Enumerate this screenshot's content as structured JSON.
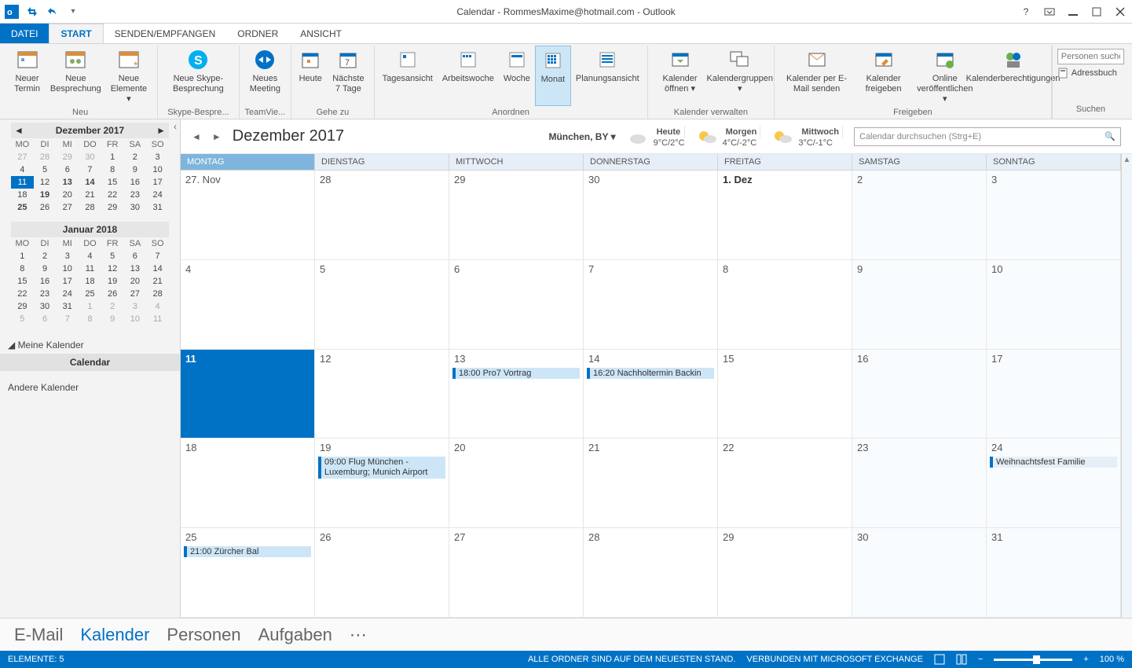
{
  "title": "Calendar - RommesMaxime@hotmail.com - Outlook",
  "tabs": {
    "file": "DATEI",
    "start": "START",
    "sendrecv": "SENDEN/EMPFANGEN",
    "folder": "ORDNER",
    "view": "ANSICHT"
  },
  "ribbon": {
    "new": {
      "termin": "Neuer Termin",
      "meeting": "Neue Besprechung",
      "elements": "Neue Elemente",
      "label": "Neu"
    },
    "skype": {
      "btn": "Neue Skype-Besprechung",
      "label": "Skype-Bespre..."
    },
    "team": {
      "btn": "Neues Meeting",
      "label": "TeamVie..."
    },
    "goto": {
      "today": "Heute",
      "next7": "Nächste 7 Tage",
      "label": "Gehe zu"
    },
    "arrange": {
      "day": "Tagesansicht",
      "work": "Arbeitswoche",
      "week": "Woche",
      "month": "Monat",
      "plan": "Planungsansicht",
      "label": "Anordnen"
    },
    "manage": {
      "open": "Kalender öffnen",
      "groups": "Kalendergruppen",
      "label": "Kalender verwalten"
    },
    "share": {
      "email": "Kalender per E-Mail senden",
      "free": "Kalender freigeben",
      "online": "Online veröffentlichen",
      "perm": "Kalenderberechtigungen",
      "label": "Freigeben"
    },
    "find": {
      "people_ph": "Personen suchen",
      "addr": "Adressbuch",
      "label": "Suchen"
    }
  },
  "minical1": {
    "title": "Dezember 2017",
    "dow": [
      "MO",
      "DI",
      "MI",
      "DO",
      "FR",
      "SA",
      "SO"
    ],
    "rows": [
      [
        {
          "n": "27",
          "g": 1
        },
        {
          "n": "28",
          "g": 1
        },
        {
          "n": "29",
          "g": 1
        },
        {
          "n": "30",
          "g": 1
        },
        {
          "n": "1"
        },
        {
          "n": "2"
        },
        {
          "n": "3"
        }
      ],
      [
        {
          "n": "4"
        },
        {
          "n": "5"
        },
        {
          "n": "6"
        },
        {
          "n": "7"
        },
        {
          "n": "8"
        },
        {
          "n": "9"
        },
        {
          "n": "10"
        }
      ],
      [
        {
          "n": "11",
          "t": 1
        },
        {
          "n": "12"
        },
        {
          "n": "13",
          "b": 1
        },
        {
          "n": "14",
          "b": 1
        },
        {
          "n": "15"
        },
        {
          "n": "16"
        },
        {
          "n": "17"
        }
      ],
      [
        {
          "n": "18"
        },
        {
          "n": "19",
          "b": 1
        },
        {
          "n": "20"
        },
        {
          "n": "21"
        },
        {
          "n": "22"
        },
        {
          "n": "23"
        },
        {
          "n": "24"
        }
      ],
      [
        {
          "n": "25",
          "b": 1
        },
        {
          "n": "26"
        },
        {
          "n": "27"
        },
        {
          "n": "28"
        },
        {
          "n": "29"
        },
        {
          "n": "30"
        },
        {
          "n": "31"
        }
      ]
    ]
  },
  "minical2": {
    "title": "Januar 2018",
    "dow": [
      "MO",
      "DI",
      "MI",
      "DO",
      "FR",
      "SA",
      "SO"
    ],
    "rows": [
      [
        {
          "n": "1"
        },
        {
          "n": "2"
        },
        {
          "n": "3"
        },
        {
          "n": "4"
        },
        {
          "n": "5"
        },
        {
          "n": "6"
        },
        {
          "n": "7"
        }
      ],
      [
        {
          "n": "8"
        },
        {
          "n": "9"
        },
        {
          "n": "10"
        },
        {
          "n": "11"
        },
        {
          "n": "12"
        },
        {
          "n": "13"
        },
        {
          "n": "14"
        }
      ],
      [
        {
          "n": "15"
        },
        {
          "n": "16"
        },
        {
          "n": "17"
        },
        {
          "n": "18"
        },
        {
          "n": "19"
        },
        {
          "n": "20"
        },
        {
          "n": "21"
        }
      ],
      [
        {
          "n": "22"
        },
        {
          "n": "23"
        },
        {
          "n": "24"
        },
        {
          "n": "25"
        },
        {
          "n": "26"
        },
        {
          "n": "27"
        },
        {
          "n": "28"
        }
      ],
      [
        {
          "n": "29"
        },
        {
          "n": "30"
        },
        {
          "n": "31"
        },
        {
          "n": "1",
          "g": 1
        },
        {
          "n": "2",
          "g": 1
        },
        {
          "n": "3",
          "g": 1
        },
        {
          "n": "4",
          "g": 1
        }
      ],
      [
        {
          "n": "5",
          "g": 1
        },
        {
          "n": "6",
          "g": 1
        },
        {
          "n": "7",
          "g": 1
        },
        {
          "n": "8",
          "g": 1
        },
        {
          "n": "9",
          "g": 1
        },
        {
          "n": "10",
          "g": 1
        },
        {
          "n": "11",
          "g": 1
        }
      ]
    ]
  },
  "sidebar": {
    "mycals": "Meine Kalender",
    "calendar": "Calendar",
    "other": "Andere Kalender"
  },
  "calview": {
    "title": "Dezember 2017",
    "location": "München, BY",
    "weather": [
      {
        "day": "Heute",
        "temp": "9°C/2°C"
      },
      {
        "day": "Morgen",
        "temp": "4°C/-2°C"
      },
      {
        "day": "Mittwoch",
        "temp": "3°C/-1°C"
      }
    ],
    "search_ph": "Calendar durchsuchen (Strg+E)",
    "dow": [
      "MONTAG",
      "DIENSTAG",
      "MITTWOCH",
      "DONNERSTAG",
      "FREITAG",
      "SAMSTAG",
      "SONNTAG"
    ],
    "weeks": [
      [
        {
          "n": "27. Nov"
        },
        {
          "n": "28"
        },
        {
          "n": "29"
        },
        {
          "n": "30"
        },
        {
          "n": "1. Dez",
          "bold": 1
        },
        {
          "n": "2",
          "off": 1
        },
        {
          "n": "3",
          "off": 1
        }
      ],
      [
        {
          "n": "4"
        },
        {
          "n": "5"
        },
        {
          "n": "6"
        },
        {
          "n": "7"
        },
        {
          "n": "8"
        },
        {
          "n": "9",
          "off": 1
        },
        {
          "n": "10",
          "off": 1
        }
      ],
      [
        {
          "n": "11",
          "today": 1
        },
        {
          "n": "12"
        },
        {
          "n": "13",
          "ev": [
            {
              "t": "18:00 Pro7 Vortrag"
            }
          ]
        },
        {
          "n": "14",
          "ev": [
            {
              "t": "16:20 Nachholtermin Backin"
            }
          ]
        },
        {
          "n": "15"
        },
        {
          "n": "16",
          "off": 1
        },
        {
          "n": "17",
          "off": 1
        }
      ],
      [
        {
          "n": "18"
        },
        {
          "n": "19",
          "ev": [
            {
              "t": "09:00 Flug München - Luxemburg; Munich Airport",
              "wrap": 1
            }
          ]
        },
        {
          "n": "20"
        },
        {
          "n": "21"
        },
        {
          "n": "22"
        },
        {
          "n": "23",
          "off": 1
        },
        {
          "n": "24",
          "off": 1,
          "ev": [
            {
              "t": "Weihnachtsfest Familie",
              "light": 1
            }
          ]
        }
      ],
      [
        {
          "n": "25",
          "ev": [
            {
              "t": "21:00 Zürcher Bal"
            }
          ]
        },
        {
          "n": "26"
        },
        {
          "n": "27"
        },
        {
          "n": "28"
        },
        {
          "n": "29"
        },
        {
          "n": "30",
          "off": 1
        },
        {
          "n": "31",
          "off": 1
        }
      ]
    ]
  },
  "nav": {
    "mail": "E-Mail",
    "cal": "Kalender",
    "people": "Personen",
    "tasks": "Aufgaben"
  },
  "status": {
    "elements": "ELEMENTE: 5",
    "folders": "ALLE ORDNER SIND AUF DEM NEUESTEN STAND.",
    "connected": "VERBUNDEN MIT MICROSOFT EXCHANGE",
    "zoom": "100 %"
  }
}
